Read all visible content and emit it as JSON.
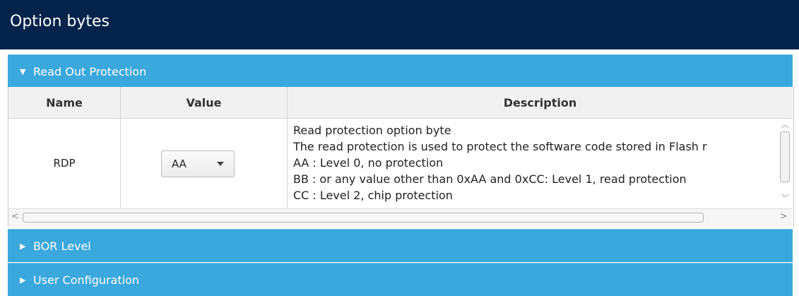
{
  "window": {
    "title": "Option bytes"
  },
  "sections": [
    {
      "label": "Read Out Protection",
      "expanded": true
    },
    {
      "label": "BOR Level",
      "expanded": false
    },
    {
      "label": "User Configuration",
      "expanded": false
    }
  ],
  "table": {
    "columns": [
      "Name",
      "Value",
      "Description"
    ],
    "rows": [
      {
        "name": "RDP",
        "value": "AA",
        "description": [
          "Read protection option byte",
          "The read protection is used to protect the software code stored in Flash r",
          "AA : Level 0, no protection",
          "BB : or any value other than 0xAA and 0xCC: Level 1, read protection",
          "CC : Level 2, chip protection"
        ]
      }
    ]
  },
  "colors": {
    "titlebar": "#03234b",
    "section_header": "#3aa8dc",
    "table_header": "#f1f1f1"
  },
  "icons": {
    "expanded": "triangle-down-icon",
    "collapsed": "triangle-right-icon",
    "dropdown": "caret-down-icon"
  }
}
